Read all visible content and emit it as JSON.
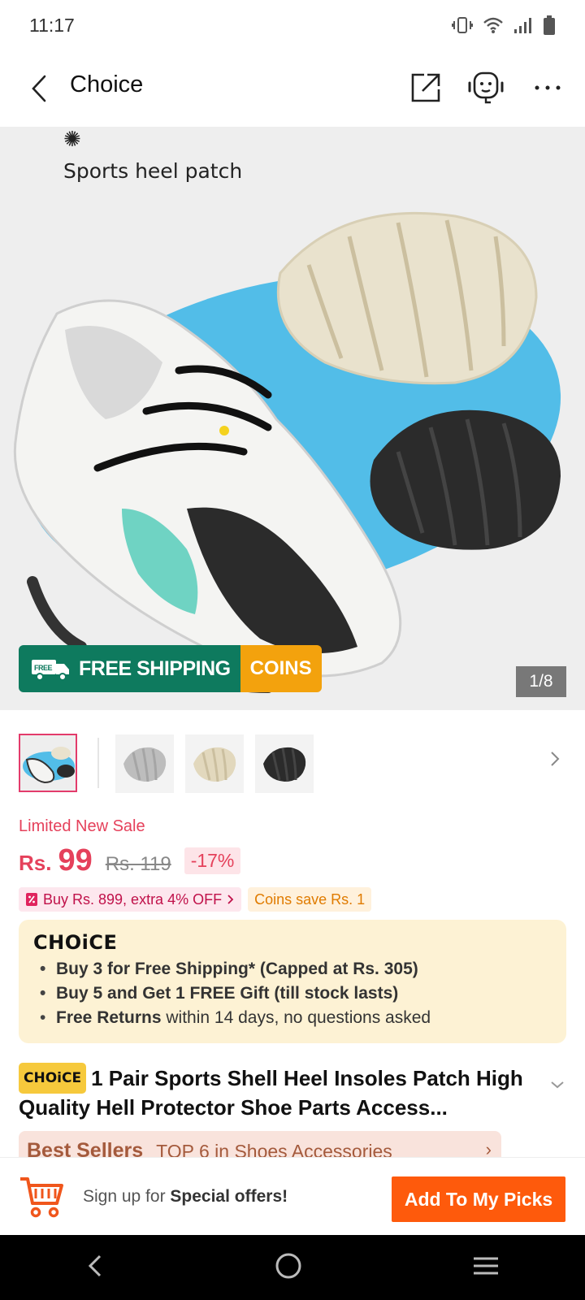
{
  "status_bar": {
    "time": "11:17"
  },
  "header": {
    "title": "Choice"
  },
  "hero": {
    "caption": "Sports heel patch",
    "free_shipping_label": "FREE SHIPPING",
    "free_tag": "FREE",
    "coins_label": "COINS",
    "counter": "1/8"
  },
  "price": {
    "sale_label": "Limited New Sale",
    "currency": "Rs.",
    "current": "99",
    "original": "Rs. 119",
    "discount": "-17%"
  },
  "promos": {
    "buy_offer": "Buy Rs. 899, extra 4% OFF",
    "coins_save": "Coins save Rs. 1"
  },
  "choice_box": {
    "logo": "CHOiCE",
    "line1": "Buy 3 for  Free Shipping* (Capped at Rs. 305)",
    "line2": "Buy 5 and Get 1 FREE Gift (till stock lasts)",
    "line3_bold": "Free Returns",
    "line3_rest": " within 14 days, no questions asked"
  },
  "product": {
    "badge": "CHOiCE",
    "title": "1 Pair Sports Shell Heel Insoles Patch High Quality Hell Protector Shoe Parts Access..."
  },
  "best_sellers": {
    "title": "Best Sellers",
    "rank": "TOP 6 in Shoes Accessories"
  },
  "bottom_bar": {
    "signup_prefix": "Sign up for ",
    "signup_bold": "Special offers!",
    "cta": "Add To My Picks"
  },
  "colors": {
    "accent": "#fe5a0c",
    "sale_red": "#e5415b",
    "shipping_green": "#0e7a5e",
    "coins_orange": "#f3a20d",
    "choice_yellow": "#fdf2d4"
  }
}
